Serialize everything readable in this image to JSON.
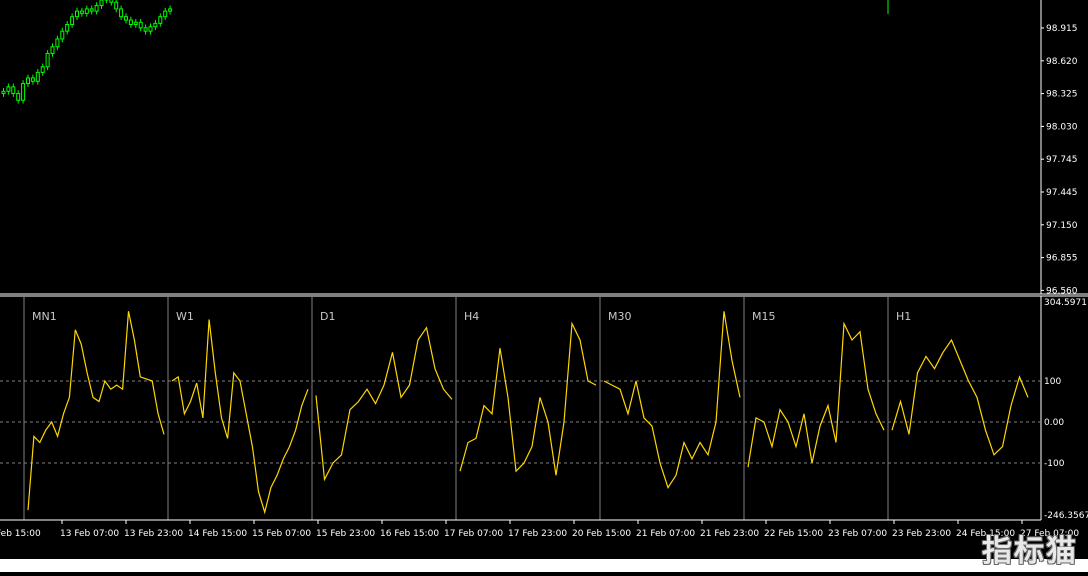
{
  "price_axis": {
    "labels": [
      "98.915",
      "98.620",
      "98.325",
      "98.030",
      "97.745",
      "97.445",
      "97.150",
      "96.855",
      "96.560"
    ]
  },
  "indicator_axis": {
    "top": "304.5971",
    "plus100": "100",
    "zero": "0.00",
    "minus100": "-100",
    "bottom": "-246.3567"
  },
  "timeframes": [
    "MN1",
    "W1",
    "D1",
    "H4",
    "M30",
    "M15",
    "H1"
  ],
  "time_axis": {
    "labels": [
      "Feb 15:00",
      "13 Feb 07:00",
      "13 Feb 23:00",
      "14 Feb 15:00",
      "15 Feb 07:00",
      "15 Feb 23:00",
      "16 Feb 15:00",
      "17 Feb 07:00",
      "17 Feb 23:00",
      "20 Feb 15:00",
      "21 Feb 07:00",
      "21 Feb 23:00",
      "22 Feb 15:00",
      "23 Feb 07:00",
      "23 Feb 23:00",
      "24 Feb 15:00",
      "27 Feb 07:00"
    ]
  },
  "colors": {
    "candles": "#00ff00",
    "indicator_line": "#ffd700",
    "background": "#000000",
    "grid": "#808080",
    "separator": "#808080"
  },
  "watermark": "指标猫",
  "chart_data": [
    {
      "type": "line",
      "title": "",
      "description_series": "price candles (partially visible, upper left)",
      "series": [
        {
          "values": [
            98.38,
            98.42,
            98.36,
            98.3,
            98.45,
            98.5,
            98.47,
            98.55,
            98.6,
            98.72,
            98.78,
            98.85,
            98.92,
            98.98,
            99.05,
            99.1,
            99.08,
            99.12,
            99.1,
            99.15,
            99.2,
            99.25,
            99.18,
            99.12,
            99.05,
            99.02,
            98.98,
            99.0,
            98.95,
            98.92,
            98.96,
            98.99,
            99.05,
            99.1,
            99.12
          ]
        }
      ],
      "ylim": [
        96.56,
        99.2
      ]
    },
    {
      "type": "line",
      "title": "",
      "ylim": [
        -246.3567,
        304.5971
      ],
      "series": [
        {
          "name": "MN1",
          "values": [
            -215,
            -35,
            -50,
            -20,
            0,
            -35,
            20,
            60,
            225,
            190,
            120,
            60,
            50,
            100,
            80,
            90,
            80,
            270,
            200,
            110,
            105,
            100,
            20,
            -30
          ]
        },
        {
          "name": "W1",
          "values": [
            100,
            110,
            20,
            50,
            95,
            10,
            250,
            120,
            10,
            -40,
            120,
            100,
            20,
            -60,
            -170,
            -220,
            -160,
            -130,
            -90,
            -60,
            -20,
            40,
            80
          ]
        },
        {
          "name": "D1",
          "values": [
            65,
            -140,
            -100,
            -80,
            30,
            50,
            80,
            45,
            90,
            170,
            60,
            90,
            200,
            230,
            130,
            80,
            55
          ]
        },
        {
          "name": "H4",
          "values": [
            -120,
            -50,
            -40,
            40,
            20,
            180,
            60,
            -120,
            -100,
            -60,
            60,
            0,
            -130,
            0,
            240,
            200,
            100,
            90
          ]
        },
        {
          "name": "M30",
          "values": [
            100,
            90,
            80,
            20,
            100,
            10,
            -10,
            -100,
            -160,
            -130,
            -50,
            -90,
            -50,
            -80,
            0,
            270,
            150,
            60
          ]
        },
        {
          "name": "M15",
          "values": [
            -110,
            10,
            0,
            -60,
            30,
            0,
            -60,
            20,
            -100,
            -10,
            40,
            -50,
            240,
            200,
            220,
            80,
            20,
            -20
          ]
        },
        {
          "name": "H1",
          "values": [
            -20,
            50,
            -30,
            120,
            160,
            130,
            170,
            200,
            150,
            100,
            60,
            -20,
            -80,
            -60,
            40,
            110,
            60
          ]
        }
      ]
    }
  ]
}
